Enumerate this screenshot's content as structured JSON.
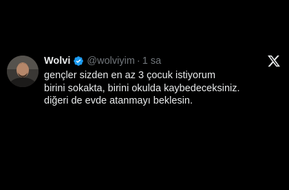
{
  "tweet": {
    "display_name": "Wolvi",
    "handle": "@wolviyim",
    "separator": "·",
    "time": "1 sa",
    "lines": [
      "gençler sizden en az 3 çocuk istiyorum",
      "birini sokakta, birini okulda kaybedeceksiniz.",
      "diğeri de evde atanmayı beklesin."
    ],
    "verified_color": "#1d9bf0",
    "icons": {
      "verified": "verified-badge-icon",
      "brand": "x-logo-icon",
      "avatar": "avatar-photo"
    }
  },
  "colors": {
    "background": "#000000",
    "primary_text": "#e7e9ea",
    "secondary_text": "#71767b"
  }
}
